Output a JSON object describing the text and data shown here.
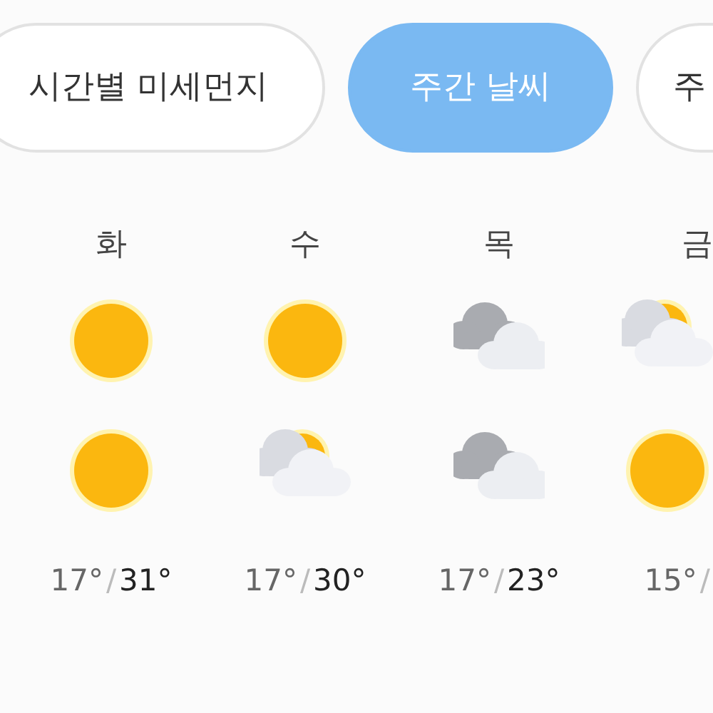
{
  "tabs": [
    {
      "label": "시간별 미세먼지",
      "selected": false
    },
    {
      "label": "주간 날씨",
      "selected": true
    },
    {
      "label": "주",
      "selected": false
    }
  ],
  "days": [
    {
      "day": "화",
      "am": {
        "kind": "sun"
      },
      "pm": {
        "kind": "sun"
      },
      "low": "17°",
      "sep": "/",
      "high": "31°"
    },
    {
      "day": "수",
      "am": {
        "kind": "sun"
      },
      "pm": {
        "kind": "partly"
      },
      "low": "17°",
      "sep": "/",
      "high": "30°"
    },
    {
      "day": "목",
      "am": {
        "kind": "cloudy"
      },
      "pm": {
        "kind": "cloudy"
      },
      "low": "17°",
      "sep": "/",
      "high": "23°"
    },
    {
      "day": "금",
      "am": {
        "kind": "partly"
      },
      "pm": {
        "kind": "sun"
      },
      "low": "15°",
      "sep": "/"
    }
  ]
}
